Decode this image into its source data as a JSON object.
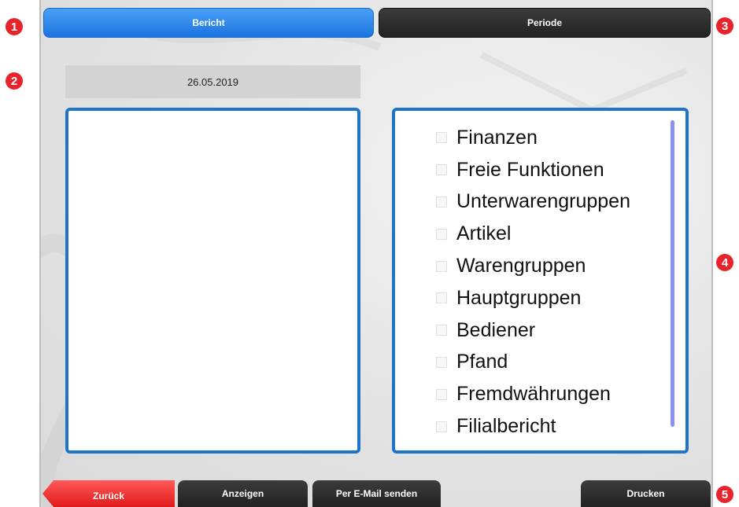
{
  "tabs": {
    "bericht_label": "Bericht",
    "periode_label": "Periode"
  },
  "date_field": {
    "value": "26.05.2019"
  },
  "report_options": [
    {
      "label": "Finanzen",
      "checked": false
    },
    {
      "label": "Freie Funktionen",
      "checked": false
    },
    {
      "label": "Unterwarengruppen",
      "checked": false
    },
    {
      "label": "Artikel",
      "checked": false
    },
    {
      "label": "Warengruppen",
      "checked": false
    },
    {
      "label": "Hauptgruppen",
      "checked": false
    },
    {
      "label": "Bediener",
      "checked": false
    },
    {
      "label": "Pfand",
      "checked": false
    },
    {
      "label": "Fremdwährungen",
      "checked": false
    },
    {
      "label": "Filialbericht",
      "checked": false
    }
  ],
  "footer": {
    "back_label": "Zurück",
    "show_label": "Anzeigen",
    "email_label": "Per E-Mail senden",
    "print_label": "Drucken"
  },
  "markers": [
    "1",
    "2",
    "3",
    "4",
    "5"
  ],
  "colors": {
    "accent_blue": "#1e74c6",
    "tab_active": "#2f86ea",
    "tab_inactive": "#2a2a2a",
    "back_button": "#e62323",
    "marker": "#e8232b",
    "scrollbar": "#8c8ff5"
  }
}
